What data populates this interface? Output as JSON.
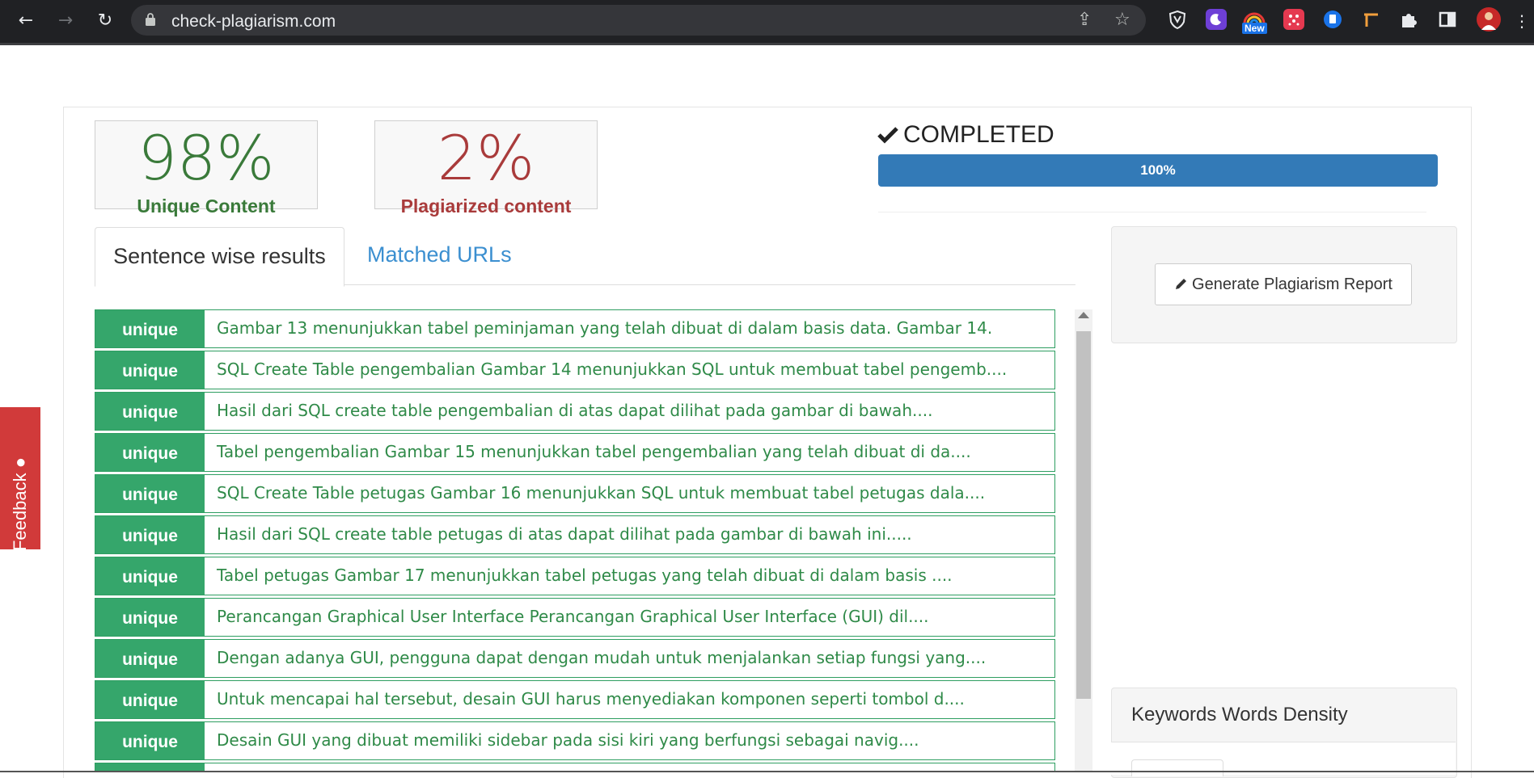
{
  "browser": {
    "url": "check-plagiarism.com",
    "ext_new_badge": "New"
  },
  "scores": {
    "unique_pct": "98%",
    "unique_label": "Unique Content",
    "plag_pct": "2%",
    "plag_label": "Plagiarized content",
    "unique_color": "#3a7a3a",
    "plag_color": "#a93b3b"
  },
  "status": {
    "label": "COMPLETED",
    "progress_text": "100%",
    "progress_value": 100
  },
  "tabs": [
    {
      "label": "Sentence wise results"
    },
    {
      "label": "Matched URLs"
    }
  ],
  "results": [
    {
      "badge": "unique",
      "text": "Gambar 13 menunjukkan tabel peminjaman yang telah dibuat di dalam basis data. Gambar 14."
    },
    {
      "badge": "unique",
      "text": "SQL Create Table pengembalian Gambar 14 menunjukkan SQL untuk membuat tabel pengemb...."
    },
    {
      "badge": "unique",
      "text": "Hasil dari SQL create table pengembalian di atas dapat dilihat pada gambar di bawah...."
    },
    {
      "badge": "unique",
      "text": "Tabel pengembalian Gambar 15 menunjukkan tabel pengembalian yang telah dibuat di da...."
    },
    {
      "badge": "unique",
      "text": "SQL Create Table petugas Gambar 16 menunjukkan SQL untuk membuat tabel petugas dala...."
    },
    {
      "badge": "unique",
      "text": "Hasil dari SQL create table petugas di atas dapat dilihat pada gambar di bawah ini....."
    },
    {
      "badge": "unique",
      "text": "Tabel petugas Gambar 17 menunjukkan tabel petugas yang telah dibuat di dalam basis ...."
    },
    {
      "badge": "unique",
      "text": "Perancangan Graphical User Interface Perancangan Graphical User Interface (GUI) dil...."
    },
    {
      "badge": "unique",
      "text": "Dengan adanya GUI, pengguna dapat dengan mudah untuk menjalankan setiap fungsi yang...."
    },
    {
      "badge": "unique",
      "text": "Untuk mencapai hal tersebut, desain GUI harus menyediakan komponen seperti tombol d...."
    },
    {
      "badge": "unique",
      "text": "Desain GUI yang dibuat memiliki sidebar pada sisi kiri yang berfungsi sebagai navig...."
    },
    {
      "badge": "",
      "text": ""
    }
  ],
  "sidebar": {
    "report_button": "Generate Plagiarism Report",
    "keywords_title": "Keywords Words Density"
  },
  "feedback": {
    "label": "Feedback"
  }
}
